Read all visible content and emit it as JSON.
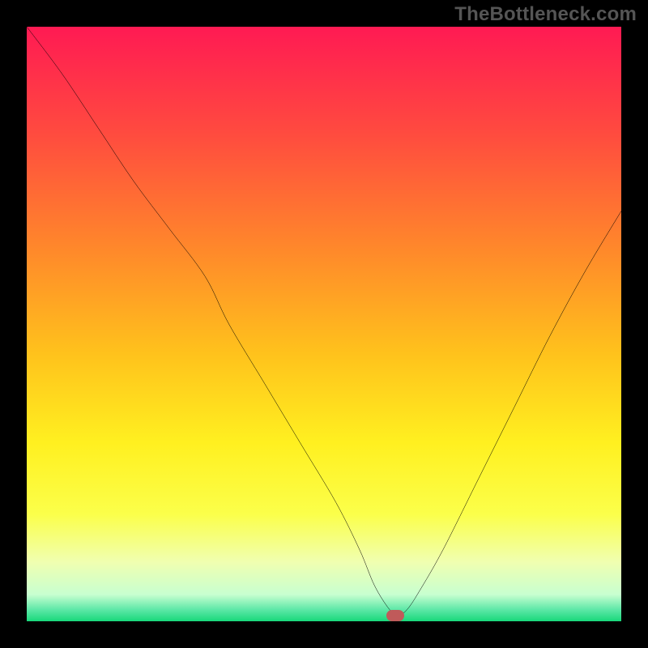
{
  "watermark": "TheBottleneck.com",
  "colors": {
    "frame": "#000000",
    "curve": "#000000",
    "marker": "#c05a5a",
    "gradient_stops": [
      {
        "offset": 0.0,
        "color": "#ff1a53"
      },
      {
        "offset": 0.18,
        "color": "#ff4b3f"
      },
      {
        "offset": 0.38,
        "color": "#ff8a2a"
      },
      {
        "offset": 0.55,
        "color": "#ffc21c"
      },
      {
        "offset": 0.7,
        "color": "#fff020"
      },
      {
        "offset": 0.82,
        "color": "#fbff4a"
      },
      {
        "offset": 0.9,
        "color": "#f0ffb0"
      },
      {
        "offset": 0.955,
        "color": "#c8ffd0"
      },
      {
        "offset": 0.98,
        "color": "#5fe8a8"
      },
      {
        "offset": 1.0,
        "color": "#18d87a"
      }
    ]
  },
  "chart_data": {
    "type": "line",
    "title": "",
    "xlabel": "",
    "ylabel": "",
    "xlim": [
      0,
      100
    ],
    "ylim": [
      0,
      100
    ],
    "note": "x in relative horizontal units (0=left,100=right), y in relative vertical units (0=top,100=bottom). Single curve with a V-shaped minimum near x≈62.",
    "series": [
      {
        "name": "bottleneck-curve",
        "x": [
          0,
          6,
          12,
          18,
          24,
          30,
          34,
          40,
          46,
          52,
          56,
          58.5,
          61,
          62.5,
          64,
          66,
          70,
          76,
          82,
          88,
          94,
          100
        ],
        "y": [
          0,
          8,
          17,
          26,
          34,
          42,
          50,
          60,
          70,
          80,
          88,
          94,
          98,
          99,
          98,
          95,
          88,
          76,
          64,
          52,
          41,
          31
        ]
      }
    ],
    "marker": {
      "x": 62,
      "y": 99
    }
  }
}
